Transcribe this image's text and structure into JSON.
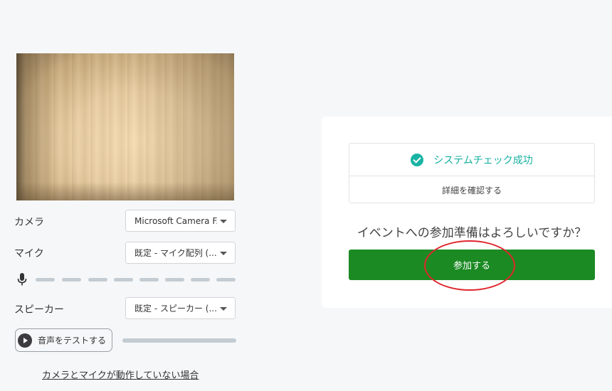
{
  "devices": {
    "camera": {
      "label": "カメラ",
      "value": "Microsoft Camera F..."
    },
    "mic": {
      "label": "マイク",
      "value": "既定 - マイク配列 (..."
    },
    "speaker": {
      "label": "スピーカー",
      "value": "既定 - スピーカー (..."
    },
    "mic_level_icon": "microphone-icon"
  },
  "test_sound": {
    "label": "音声をテストする",
    "icon": "play-icon"
  },
  "help_link": "カメラとマイクが動作していない場合",
  "status": {
    "title": "システムチェック成功",
    "details": "詳細を確認する",
    "icon": "check-circle-icon",
    "color": "#18b4a3"
  },
  "prompt": "イベントへの参加準備はよろしいですか？",
  "join_button": {
    "label": "参加する",
    "color": "#1b8a23"
  },
  "annotation_color": "#e0262e"
}
